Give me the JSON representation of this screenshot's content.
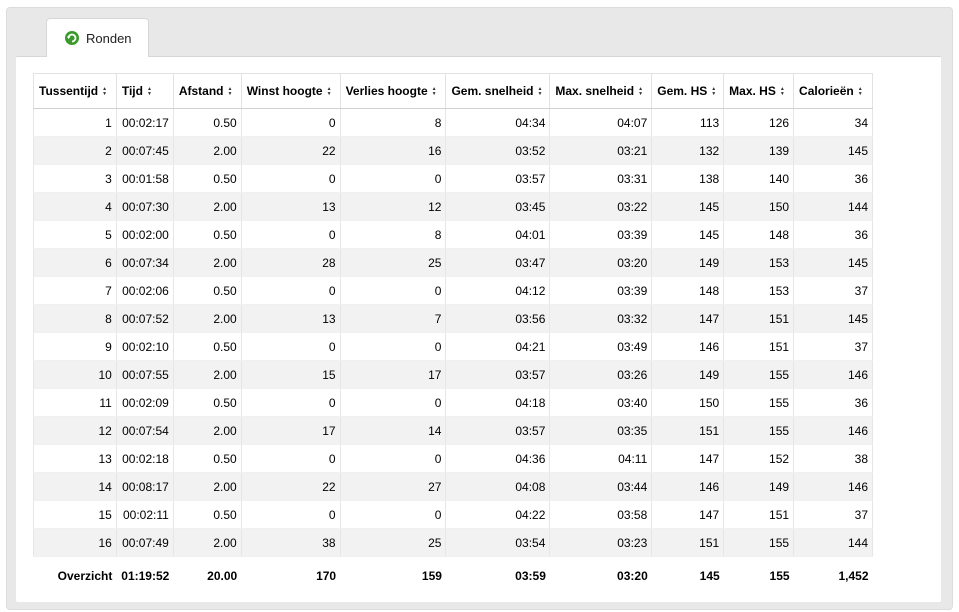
{
  "tabs": [
    {
      "label": "Ronden",
      "icon": "refresh-icon"
    }
  ],
  "table": {
    "columns": [
      "Tussentijd",
      "Tijd",
      "Afstand",
      "Winst hoogte",
      "Verlies hoogte",
      "Gem. snelheid",
      "Max. snelheid",
      "Gem. HS",
      "Max. HS",
      "Calorieën"
    ],
    "rows": [
      [
        "1",
        "00:02:17",
        "0.50",
        "0",
        "8",
        "04:34",
        "04:07",
        "113",
        "126",
        "34"
      ],
      [
        "2",
        "00:07:45",
        "2.00",
        "22",
        "16",
        "03:52",
        "03:21",
        "132",
        "139",
        "145"
      ],
      [
        "3",
        "00:01:58",
        "0.50",
        "0",
        "0",
        "03:57",
        "03:31",
        "138",
        "140",
        "36"
      ],
      [
        "4",
        "00:07:30",
        "2.00",
        "13",
        "12",
        "03:45",
        "03:22",
        "145",
        "150",
        "144"
      ],
      [
        "5",
        "00:02:00",
        "0.50",
        "0",
        "8",
        "04:01",
        "03:39",
        "145",
        "148",
        "36"
      ],
      [
        "6",
        "00:07:34",
        "2.00",
        "28",
        "25",
        "03:47",
        "03:20",
        "149",
        "153",
        "145"
      ],
      [
        "7",
        "00:02:06",
        "0.50",
        "0",
        "0",
        "04:12",
        "03:39",
        "148",
        "153",
        "37"
      ],
      [
        "8",
        "00:07:52",
        "2.00",
        "13",
        "7",
        "03:56",
        "03:32",
        "147",
        "151",
        "145"
      ],
      [
        "9",
        "00:02:10",
        "0.50",
        "0",
        "0",
        "04:21",
        "03:49",
        "146",
        "151",
        "37"
      ],
      [
        "10",
        "00:07:55",
        "2.00",
        "15",
        "17",
        "03:57",
        "03:26",
        "149",
        "155",
        "146"
      ],
      [
        "11",
        "00:02:09",
        "0.50",
        "0",
        "0",
        "04:18",
        "03:40",
        "150",
        "155",
        "36"
      ],
      [
        "12",
        "00:07:54",
        "2.00",
        "17",
        "14",
        "03:57",
        "03:35",
        "151",
        "155",
        "146"
      ],
      [
        "13",
        "00:02:18",
        "0.50",
        "0",
        "0",
        "04:36",
        "04:11",
        "147",
        "152",
        "38"
      ],
      [
        "14",
        "00:08:17",
        "2.00",
        "22",
        "27",
        "04:08",
        "03:44",
        "146",
        "149",
        "146"
      ],
      [
        "15",
        "00:02:11",
        "0.50",
        "0",
        "0",
        "04:22",
        "03:58",
        "147",
        "151",
        "37"
      ],
      [
        "16",
        "00:07:49",
        "2.00",
        "38",
        "25",
        "03:54",
        "03:23",
        "151",
        "155",
        "144"
      ]
    ],
    "footer": [
      "Overzicht",
      "01:19:52",
      "20.00",
      "170",
      "159",
      "03:59",
      "03:20",
      "145",
      "155",
      "1,452"
    ]
  }
}
